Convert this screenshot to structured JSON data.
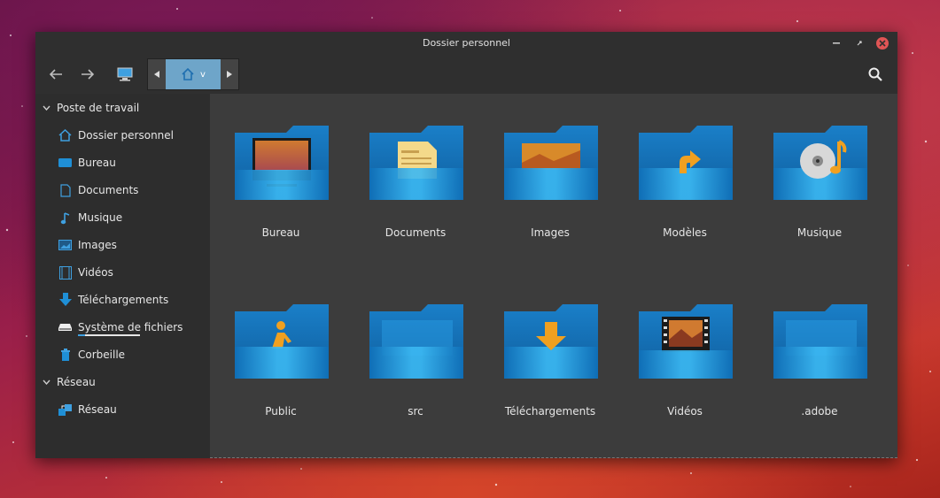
{
  "window": {
    "title": "Dossier personnel"
  },
  "toolbar": {
    "path_home_label": "v"
  },
  "sidebar": {
    "sections": [
      {
        "title": "Poste de travail",
        "items": [
          {
            "label": "Dossier personnel",
            "icon": "home-icon"
          },
          {
            "label": "Bureau",
            "icon": "desktop-icon"
          },
          {
            "label": "Documents",
            "icon": "document-icon"
          },
          {
            "label": "Musique",
            "icon": "music-note-icon"
          },
          {
            "label": "Images",
            "icon": "image-icon"
          },
          {
            "label": "Vidéos",
            "icon": "film-icon"
          },
          {
            "label": "Téléchargements",
            "icon": "download-arrow-icon"
          },
          {
            "label": "Système de fichiers",
            "icon": "drive-icon"
          },
          {
            "label": "Corbeille",
            "icon": "trash-icon"
          }
        ]
      },
      {
        "title": "Réseau",
        "items": [
          {
            "label": "Réseau",
            "icon": "network-icon"
          }
        ]
      }
    ]
  },
  "folders": [
    {
      "label": "Bureau",
      "emblem": "desktop"
    },
    {
      "label": "Documents",
      "emblem": "document"
    },
    {
      "label": "Images",
      "emblem": "image"
    },
    {
      "label": "Modèles",
      "emblem": "template-arrow"
    },
    {
      "label": "Musique",
      "emblem": "music"
    },
    {
      "label": "Public",
      "emblem": "person"
    },
    {
      "label": "src",
      "emblem": "none"
    },
    {
      "label": "Téléchargements",
      "emblem": "download"
    },
    {
      "label": "Vidéos",
      "emblem": "video"
    },
    {
      "label": ".adobe",
      "emblem": "none"
    }
  ],
  "colors": {
    "folder_blue": "#1f8fd6",
    "folder_light": "#3bb4f0",
    "emblem_orange": "#f0a020",
    "path_active": "#6ea5c9"
  }
}
